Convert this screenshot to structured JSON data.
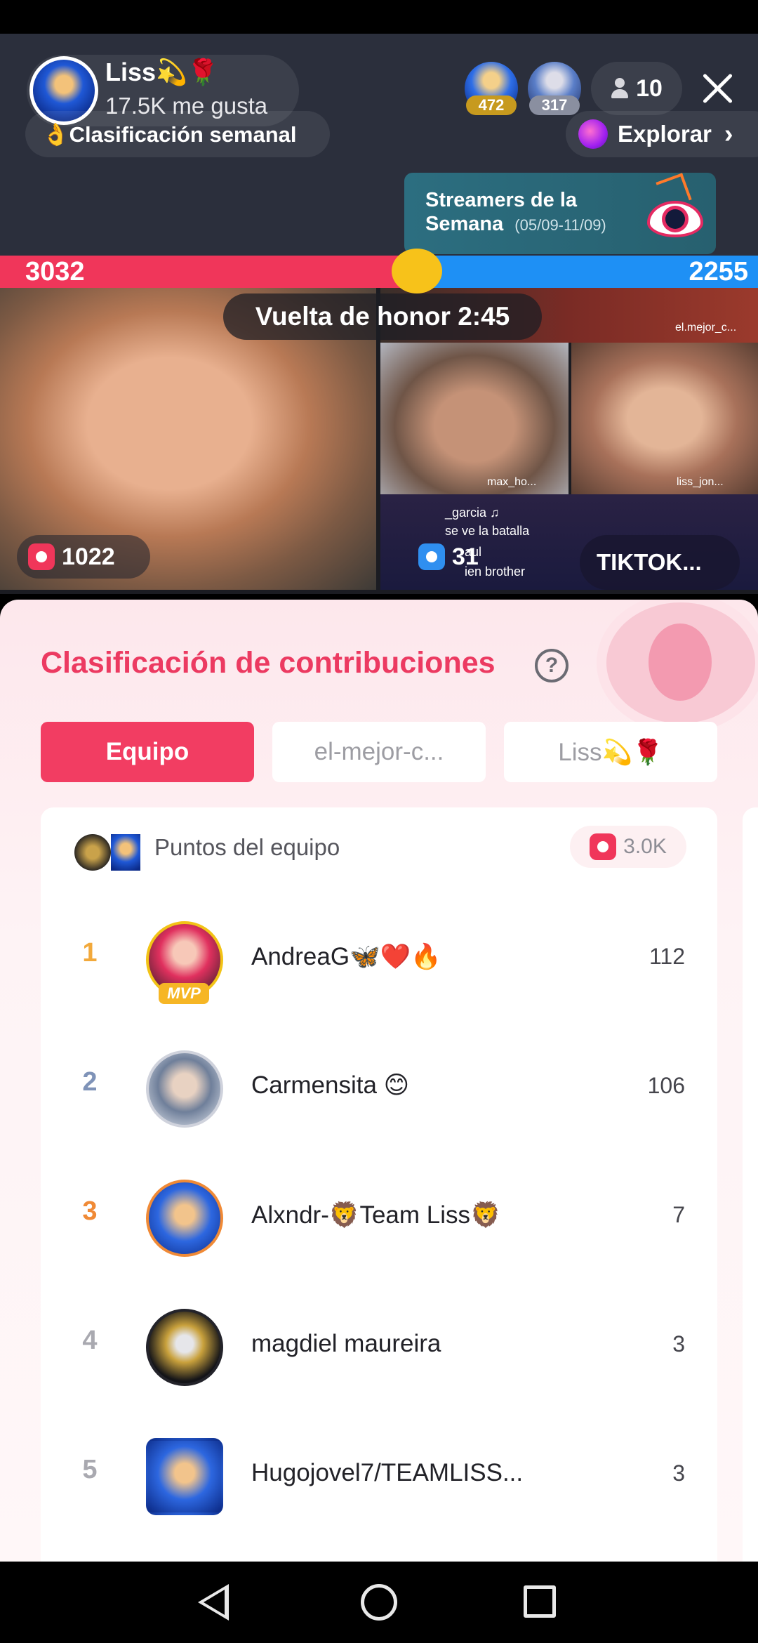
{
  "host": {
    "name": "Liss💫🌹",
    "likes": "17.5K me gusta"
  },
  "viewers": {
    "top1_badge": "472",
    "top2_badge": "317",
    "count": "10"
  },
  "weekly_ranking": {
    "label": "👌Clasificación semanal"
  },
  "explore": {
    "label": "Explorar",
    "chevron": "›"
  },
  "streamers_card": {
    "title": "Streamers de la Semana",
    "dates": "(05/09-11/09)"
  },
  "battle": {
    "left_score": "3032",
    "right_score": "2255",
    "honor_lap": "Vuelta de honor 2:45",
    "left_gift_count": "1022",
    "right_gift_count": "31",
    "right_name_pill": "TIKTOK...",
    "tile_labels": [
      "el.mejor_c...",
      "max_ho...",
      "liss_jon..."
    ],
    "chat_lines": [
      "_garcia ♫",
      "se ve la batalla",
      "aul",
      "ien brother"
    ],
    "colors": {
      "red": "#f0365a",
      "blue": "#1e90f5"
    }
  },
  "panel": {
    "title": "Clasificación de contribuciones",
    "help": "?",
    "tabs": [
      "Equipo",
      "el-mejor-c...",
      "Liss💫🌹"
    ],
    "team_label": "Puntos del equipo",
    "team_points": "3.0K",
    "mvp_badge": "MVP",
    "rows": [
      {
        "rank": "1",
        "name": "AndreaG🦋❤️🔥",
        "score": "112",
        "rank_color": "#f2a93b"
      },
      {
        "rank": "2",
        "name": "Carmensita 😊",
        "score": "106",
        "rank_color": "#7f93b8"
      },
      {
        "rank": "3",
        "name": "Alxndr-🦁Team Liss🦁",
        "score": "7",
        "rank_color": "#f08a36"
      },
      {
        "rank": "4",
        "name": "magdiel maureira",
        "score": "3",
        "rank_color": "#a9a9b0"
      },
      {
        "rank": "5",
        "name": "Hugojovel7/TEAMLISS...",
        "score": "3",
        "rank_color": "#a9a9b0"
      }
    ]
  },
  "icons": {
    "close": "close-icon",
    "person": "person-icon",
    "planet": "planet-icon",
    "gift": "gift-icon",
    "help": "help-icon",
    "back": "nav-back-icon",
    "home": "nav-home-icon",
    "recents": "nav-recents-icon"
  },
  "accent_color": "#f23d62"
}
